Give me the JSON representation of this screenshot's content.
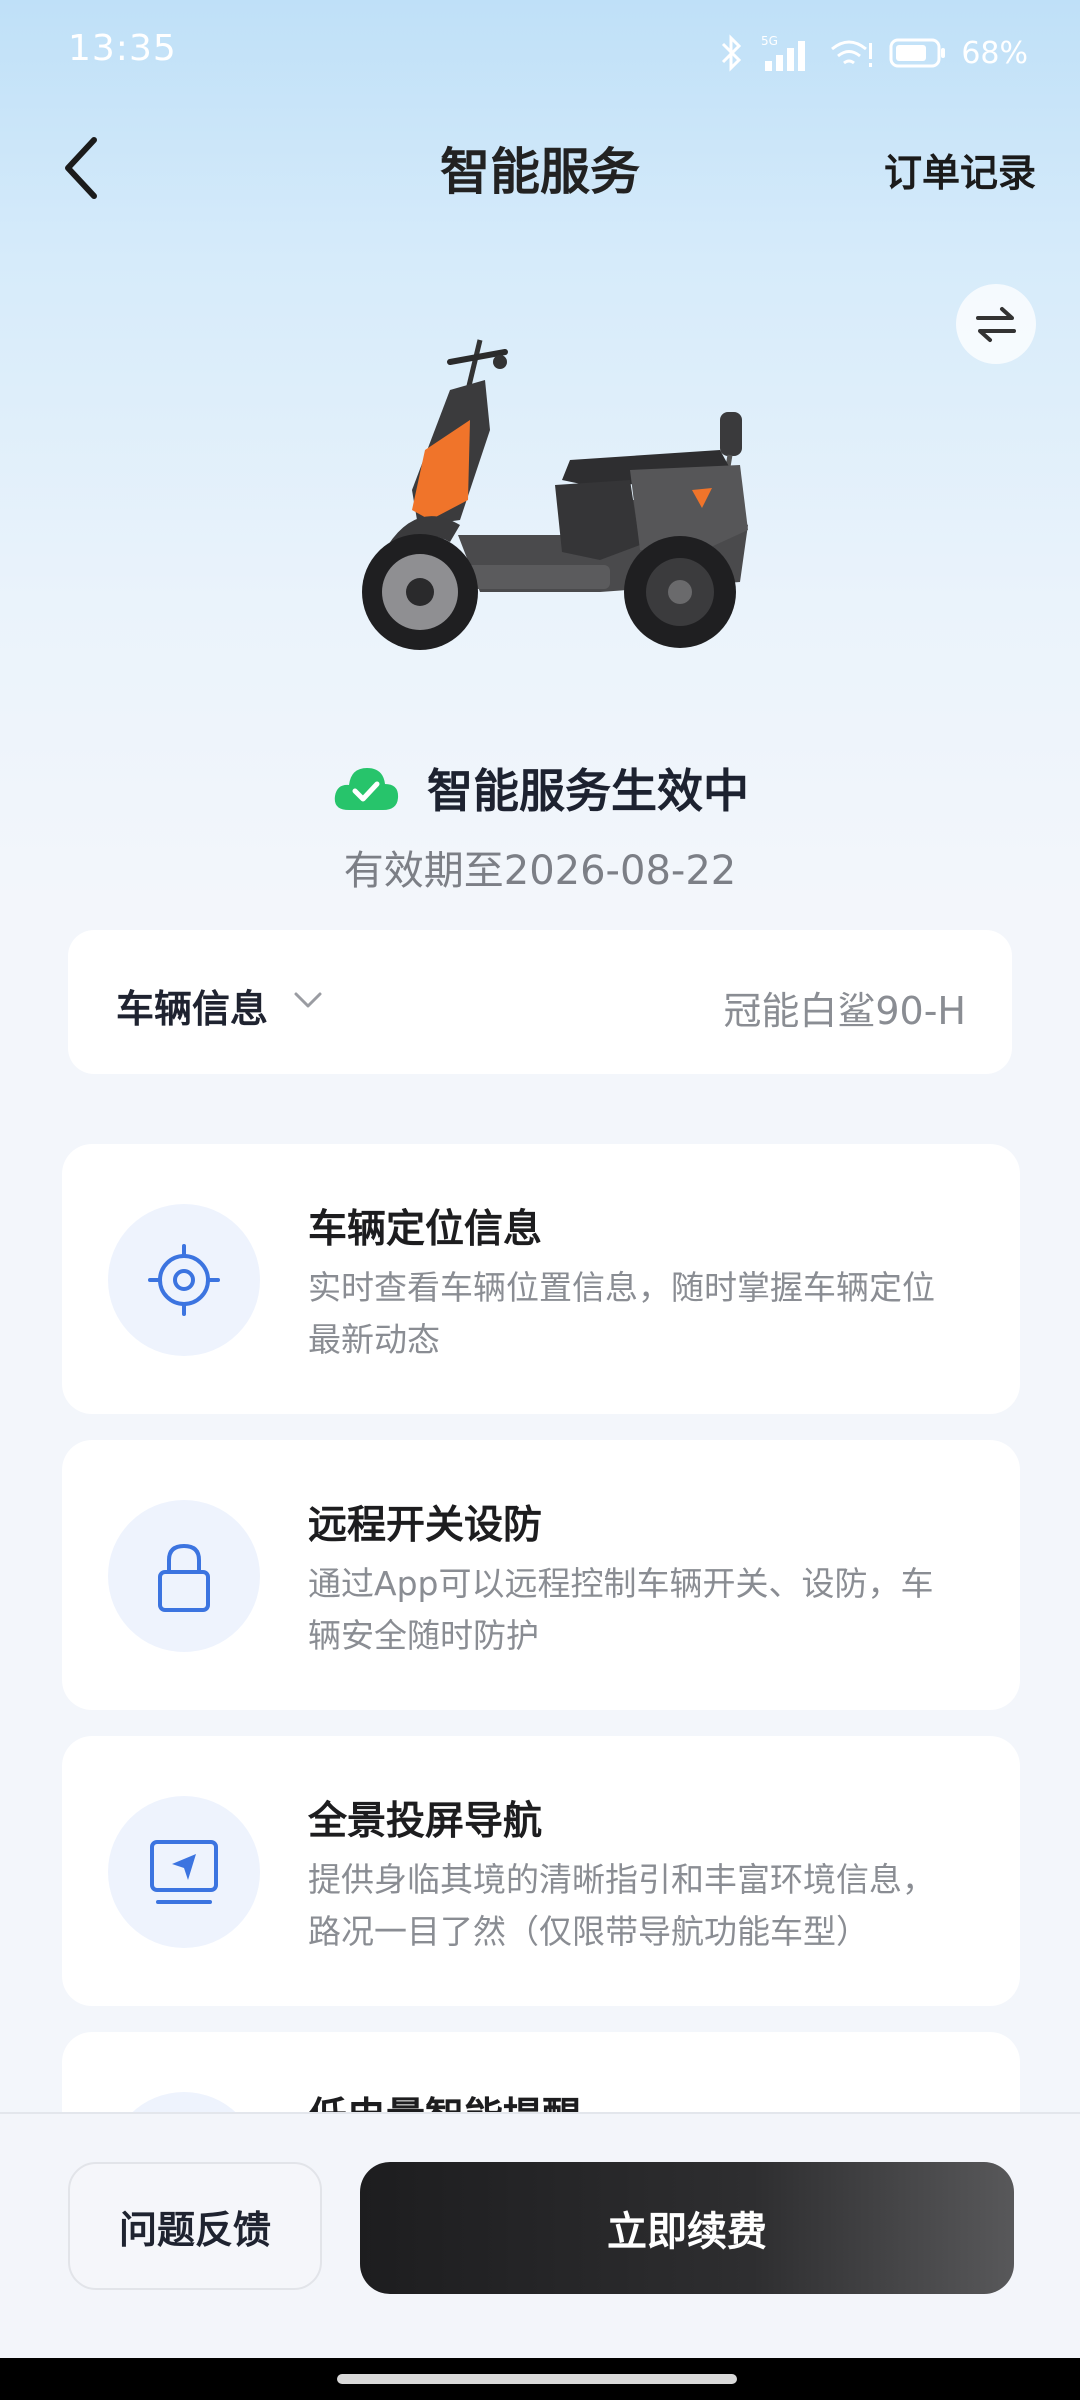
{
  "status_bar": {
    "time": "13:35",
    "network": "5G",
    "battery_percent": "68%"
  },
  "header": {
    "title": "智能服务",
    "order_link": "订单记录"
  },
  "service_status": {
    "text": "智能服务生效中",
    "expiry": "有效期至2026-08-22"
  },
  "vehicle_info": {
    "label": "车辆信息",
    "name": "冠能白鲨90-H"
  },
  "features": [
    {
      "title": "车辆定位信息",
      "desc_line1": "实时查看车辆位置信息，随时掌握车辆定位",
      "desc_line2": "最新动态",
      "icon": "location-target-icon"
    },
    {
      "title": "远程开关设防",
      "desc_line1": "通过App可以远程控制车辆开关、设防，车",
      "desc_line2": "辆安全随时防护",
      "icon": "lock-icon"
    },
    {
      "title": "全景投屏导航",
      "desc_line1": "提供身临其境的清晰指引和丰富环境信息，",
      "desc_line2": "路况一目了然（仅限带导航功能车型）",
      "icon": "screen-navigation-icon"
    },
    {
      "title": "低电量智能提醒",
      "icon": "battery-icon"
    }
  ],
  "bottom": {
    "feedback_label": "问题反馈",
    "renew_label": "立即续费"
  },
  "colors": {
    "accent_blue": "#3c74e0",
    "success_green": "#27c46b",
    "primary_dark": "#1d1d1f"
  }
}
